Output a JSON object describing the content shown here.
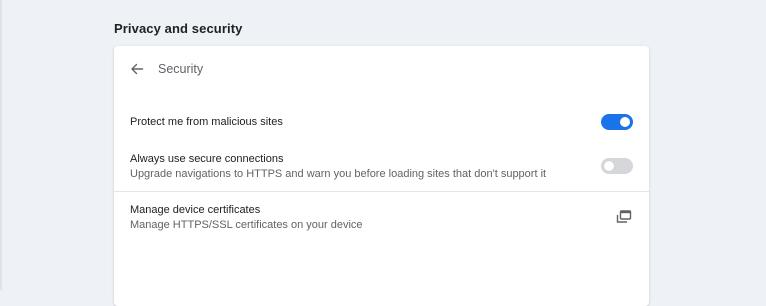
{
  "section_title": "Privacy and security",
  "subpage": {
    "title": "Security",
    "back_icon": "arrow-back-icon"
  },
  "settings": [
    {
      "title": "Protect me from malicious sites",
      "sublabel": "",
      "control": "toggle",
      "checked": true
    },
    {
      "title": "Always use secure connections",
      "sublabel": "Upgrade navigations to HTTPS and warn you before loading sites that don't support it",
      "control": "toggle",
      "checked": false
    },
    {
      "title": "Manage device certificates",
      "sublabel": "Manage HTTPS/SSL certificates on your device",
      "control": "external-link",
      "icon": "open-in-new-window-icon"
    }
  ],
  "colors": {
    "accent": "#1a73e8",
    "page_bg": "#eef1f5",
    "toggle_off": "#d5d7db"
  }
}
